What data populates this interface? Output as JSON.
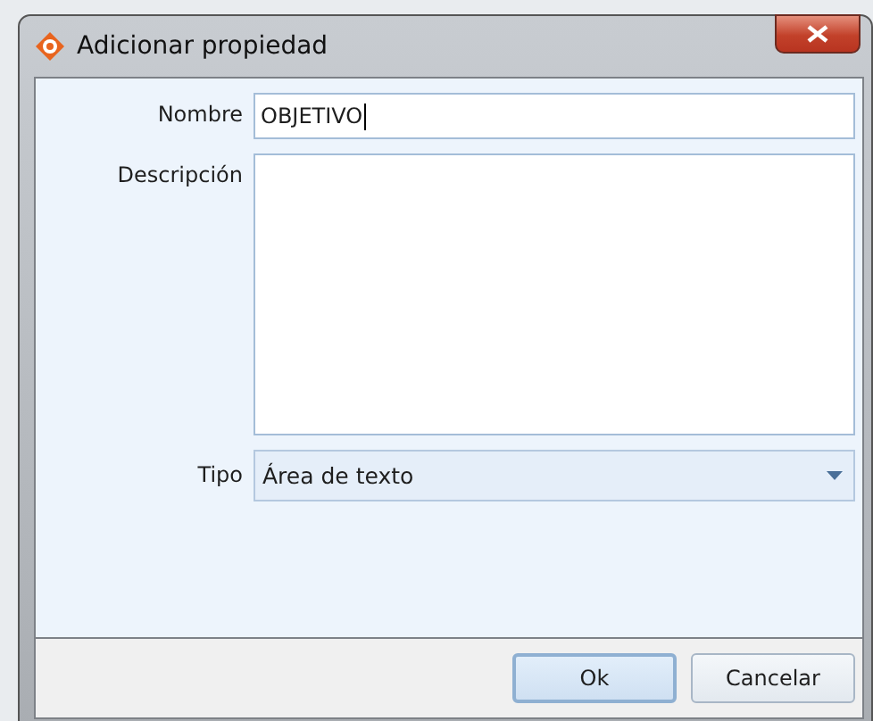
{
  "window": {
    "title": "Adicionar propiedad"
  },
  "fields": [
    {
      "kind": "text",
      "label": "Nombre",
      "value": "OBJETIVO"
    },
    {
      "kind": "textarea",
      "label": "Descripción"
    },
    {
      "kind": "dropdown",
      "label": "Tipo",
      "value": "Área de texto"
    }
  ],
  "buttons": [
    {
      "label": "Ok",
      "default": true
    },
    {
      "label": "Cancelar",
      "default": false
    }
  ]
}
